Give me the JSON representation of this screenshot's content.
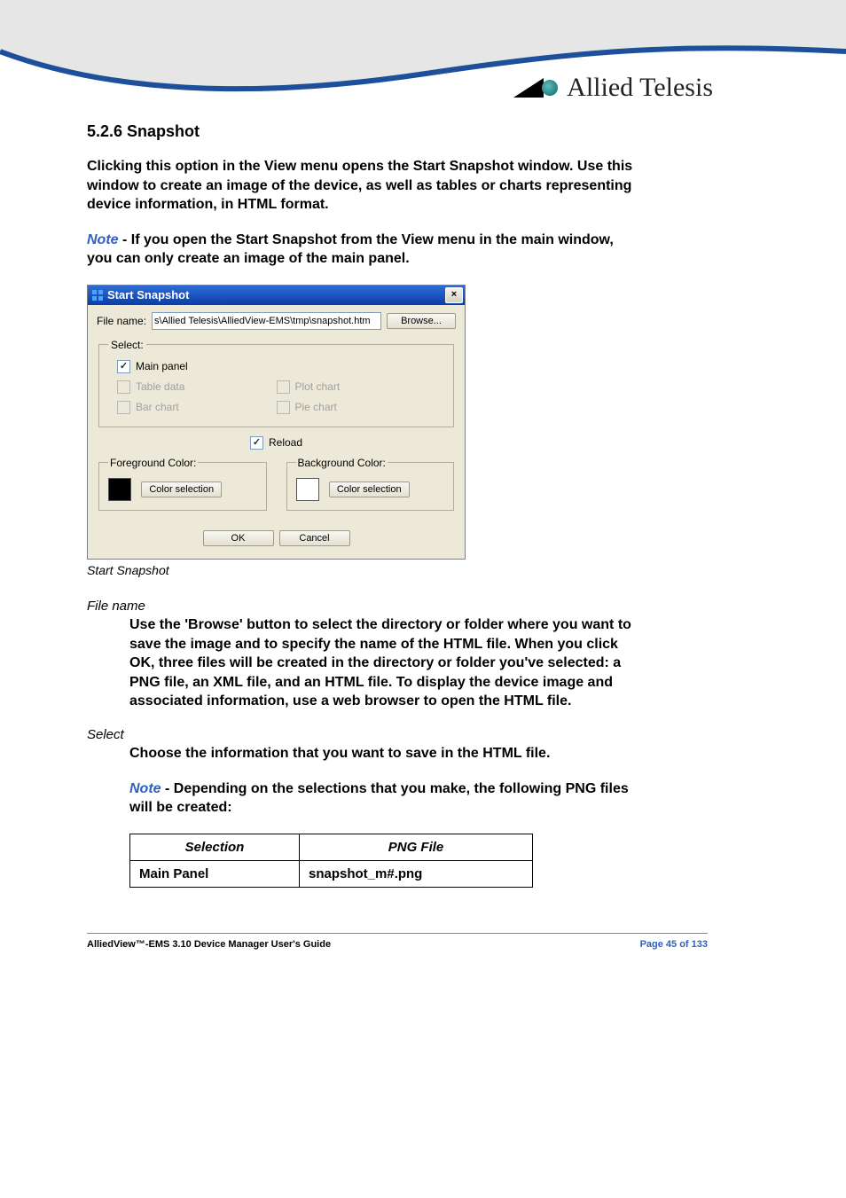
{
  "brand_text": "Allied Telesis",
  "section": {
    "number_title": "5.2.6 Snapshot",
    "intro": "Clicking this option in the View menu opens the Start Snapshot window. Use this window to create an image of the device, as well as tables or charts representing device information, in HTML format.",
    "note_label": "Note",
    "note_body": " - If you open the Start Snapshot from the View menu in the main window, you can only create an image of the main panel."
  },
  "dialog": {
    "title": "Start Snapshot",
    "close_glyph": "×",
    "file_name_label": "File name:",
    "file_name_value": "s\\Allied Telesis\\AlliedView-EMS\\tmp\\snapshot.htm",
    "browse_btn": "Browse...",
    "select_legend": "Select:",
    "cb_main_panel": "Main panel",
    "cb_table_data": "Table data",
    "cb_plot_chart": "Plot chart",
    "cb_bar_chart": "Bar chart",
    "cb_pie_chart": "Pie chart",
    "reload": "Reload",
    "fg_legend": "Foreground Color:",
    "bg_legend": "Background Color:",
    "color_sel_btn": "Color selection",
    "ok_btn": "OK",
    "cancel_btn": "Cancel"
  },
  "figure_caption": "Start Snapshot",
  "terms": {
    "file_name_title": "File name",
    "file_name_body": "Use the 'Browse' button to select the directory or folder where you want to save the image and to specify the name of the HTML file. When you click OK, three files will be created in the directory or folder you've selected: a PNG file, an XML file, and an HTML file. To display the device image and associated information, use a web browser to open the HTML file.",
    "select_title": "Select",
    "select_body": "Choose the information that you want to save in the HTML file.",
    "select_note_body": " - Depending on the selections that you make, the following PNG files will be created:"
  },
  "table": {
    "col1": "Selection",
    "col2": "PNG File",
    "row1c1": "Main Panel",
    "row1c2": "snapshot_m#.png"
  },
  "footer": {
    "left": "AlliedView™-EMS 3.10 Device Manager User's Guide",
    "right": "Page 45 of 133"
  }
}
